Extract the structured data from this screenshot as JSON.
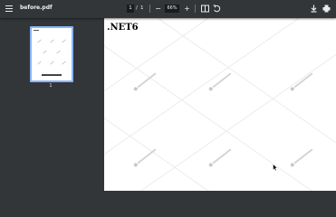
{
  "toolbar": {
    "filename": "before.pdf",
    "current_page": "1",
    "page_separator": "/",
    "total_pages": "1",
    "zoom_out_label": "−",
    "zoom_level": "66%",
    "zoom_in_label": "+"
  },
  "sidebar": {
    "thumbnails": [
      {
        "label": "1"
      }
    ]
  },
  "document": {
    "heading": ".NET6"
  },
  "colors": {
    "toolbar_bg": "#323639",
    "thumbnail_selected_border": "#8ab4f8",
    "page_bg": "#ffffff"
  },
  "icons": [
    "menu-icon",
    "fit-page-icon",
    "rotate-icon",
    "download-icon",
    "print-icon"
  ]
}
